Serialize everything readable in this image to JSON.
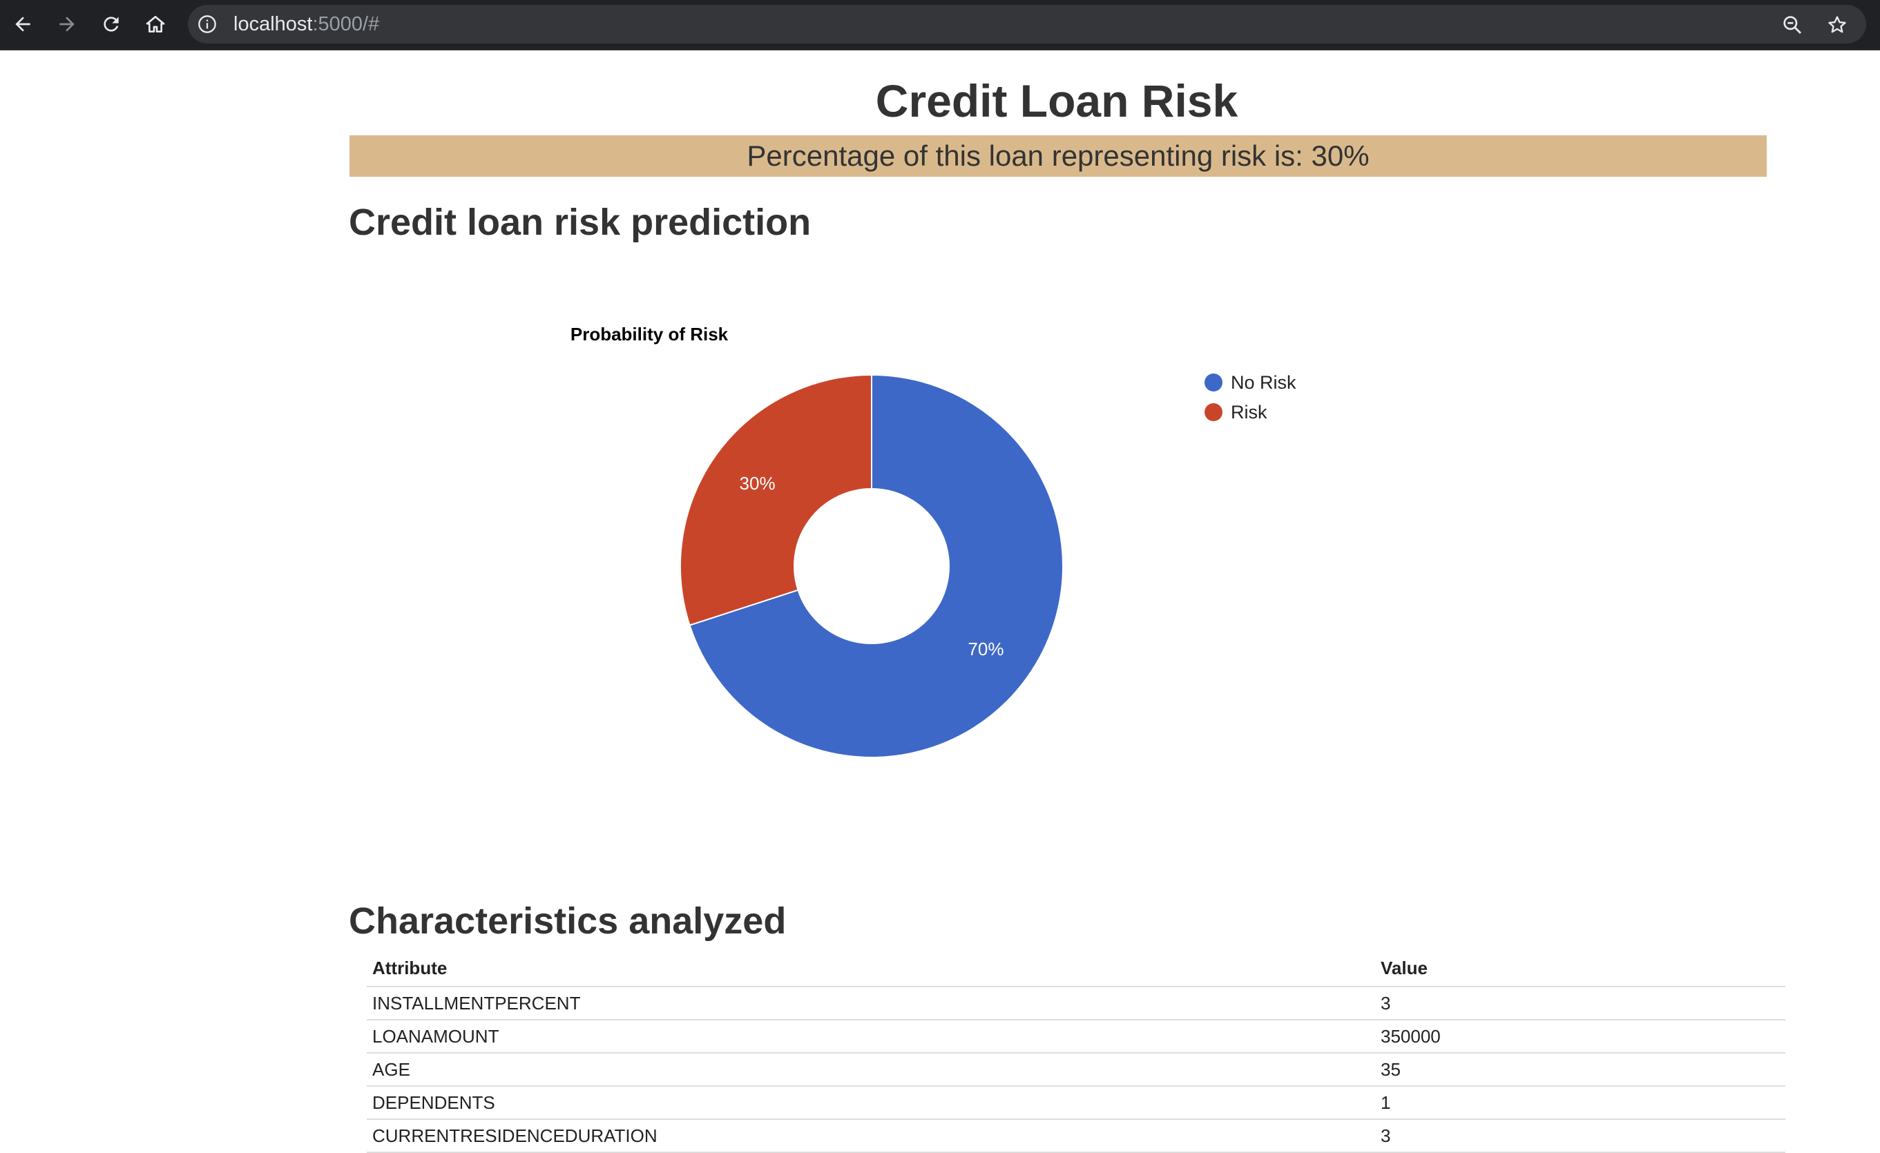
{
  "browser": {
    "url_host": "localhost",
    "url_rest": ":5000/#",
    "icons": [
      "back-arrow-icon",
      "forward-arrow-icon",
      "reload-icon",
      "home-icon",
      "info-icon",
      "zoom-icon",
      "star-icon"
    ]
  },
  "page": {
    "title": "Credit Loan Risk",
    "banner": "Percentage of this loan representing risk is: 30%",
    "prediction_heading": "Credit loan risk prediction",
    "characteristics_heading": "Characteristics analyzed"
  },
  "chart_data": {
    "type": "pie",
    "title": "Probability of Risk",
    "donut": true,
    "labels": [
      "No Risk",
      "Risk"
    ],
    "values": [
      70,
      30
    ],
    "slice_labels": [
      "70%",
      "30%"
    ],
    "colors": [
      "#3d68c7",
      "#c9452a"
    ],
    "legend": "right"
  },
  "table": {
    "headers": [
      "Attribute",
      "Value"
    ],
    "rows": [
      [
        "INSTALLMENTPERCENT",
        "3"
      ],
      [
        "LOANAMOUNT",
        "350000"
      ],
      [
        "AGE",
        "35"
      ],
      [
        "DEPENDENTS",
        "1"
      ],
      [
        "CURRENTRESIDENCEDURATION",
        "3"
      ]
    ]
  }
}
